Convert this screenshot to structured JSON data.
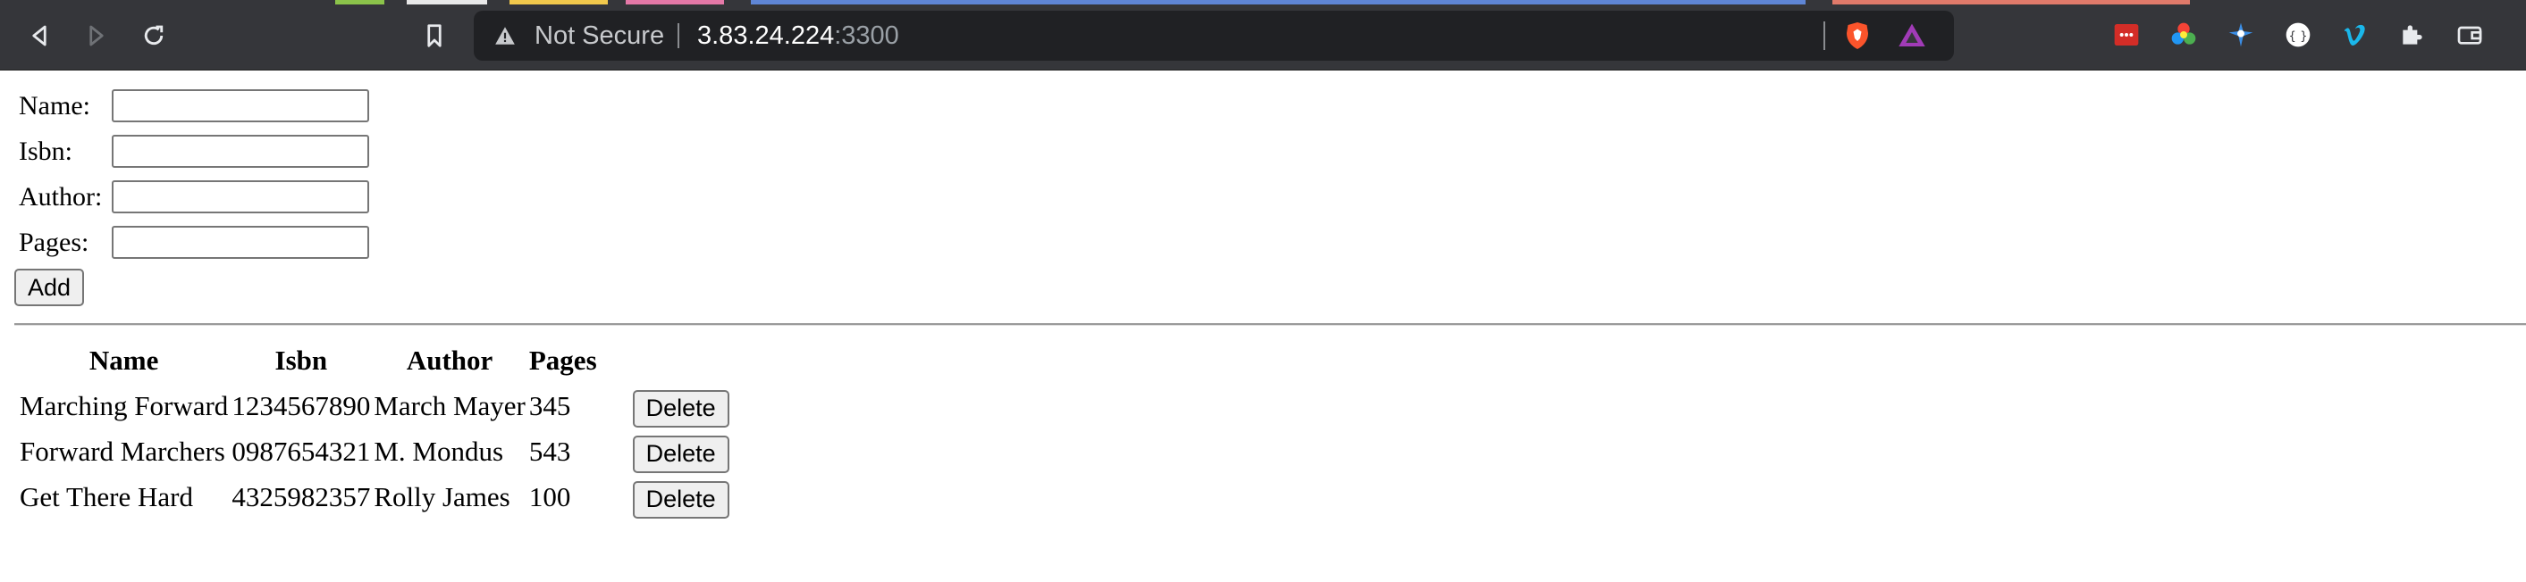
{
  "browser": {
    "security_label": "Not Secure",
    "url_host": "3.83.24.224",
    "url_port": ":3300",
    "icons": [
      "back-icon",
      "forward-icon",
      "reload-icon",
      "bookmark-icon",
      "warning-icon",
      "brave-shield-icon",
      "brave-rewards-icon",
      "lastpass-icon",
      "color-wheel-icon",
      "extension-blue-icon",
      "extension-circle-icon",
      "vimeo-icon",
      "extensions-puzzle-icon",
      "wallet-icon"
    ],
    "colors": {
      "chrome": "#35363a",
      "omnibox": "#202124"
    }
  },
  "form": {
    "name_label": "Name:",
    "isbn_label": "Isbn:",
    "author_label": "Author:",
    "pages_label": "Pages:",
    "name_value": "",
    "isbn_value": "",
    "author_value": "",
    "pages_value": "",
    "add_label": "Add"
  },
  "table": {
    "headers": {
      "name": "Name",
      "isbn": "Isbn",
      "author": "Author",
      "pages": "Pages"
    },
    "delete_label": "Delete",
    "rows": [
      {
        "name": "Marching Forward",
        "isbn": "1234567890",
        "author": "March Mayer",
        "pages": "345"
      },
      {
        "name": "Forward Marchers",
        "isbn": "0987654321",
        "author": "M. Mondus",
        "pages": "543"
      },
      {
        "name": "Get There Hard",
        "isbn": "4325982357",
        "author": "Rolly James",
        "pages": "100"
      }
    ]
  }
}
